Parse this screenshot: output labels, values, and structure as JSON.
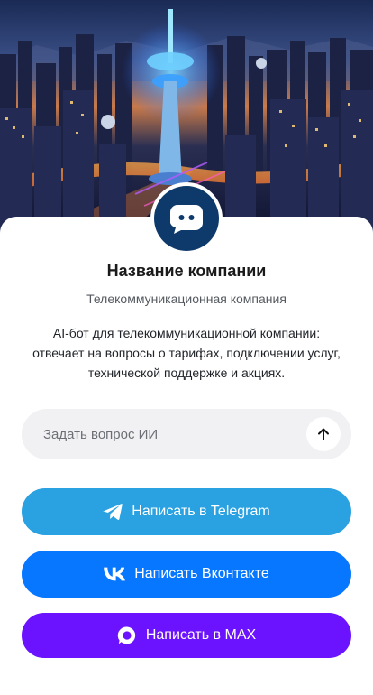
{
  "hero": {
    "image_icon": "city-telecom-tower-illustration"
  },
  "company": {
    "avatar_icon": "chat-bot-icon",
    "name": "Название компании",
    "category": "Телекоммуникационная компания",
    "description": "AI-бот для телекоммуникационной компании: отвечает на вопросы о тарифах, подключении услуг, технической поддержке и акциях."
  },
  "ask": {
    "placeholder": "Задать вопрос ИИ",
    "value": "",
    "send_icon": "arrow-up-icon"
  },
  "buttons": {
    "telegram": {
      "label": "Написать в Telegram",
      "icon": "telegram-icon",
      "color": "#2aa1e0"
    },
    "vk": {
      "label": "Написать Вконтакте",
      "icon": "vk-icon",
      "color": "#0877ff"
    },
    "max": {
      "label": "Написать в MAX",
      "icon": "max-icon",
      "color": "#6b12ff"
    }
  },
  "colors": {
    "avatar_bg": "#0e3a6b",
    "input_bg": "#f1f1f3"
  }
}
